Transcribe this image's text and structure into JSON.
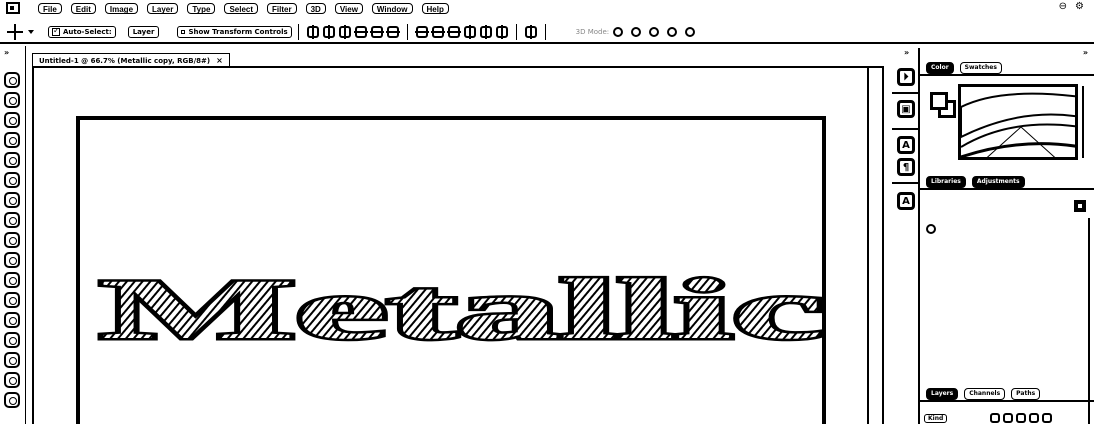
{
  "menubar": {
    "items": [
      "File",
      "Edit",
      "Image",
      "Layer",
      "Type",
      "Select",
      "Filter",
      "3D",
      "View",
      "Window",
      "Help"
    ]
  },
  "options": {
    "auto_select_label": "Auto-Select:",
    "auto_select_value": "Layer",
    "show_transform_label": "Show Transform Controls",
    "mode_3d_label": "3D Mode:"
  },
  "document": {
    "tab_title": "Untitled-1 @ 66.7% (Metallic copy, RGB/8#)",
    "close_glyph": "×",
    "canvas_text": "Metallic"
  },
  "panels": {
    "color_tab": "Color",
    "swatches_tab": "Swatches",
    "libraries_tab": "Libraries",
    "adjustments_tab": "Adjustments",
    "layers_tab": "Layers",
    "channels_tab": "Channels",
    "paths_tab": "Paths",
    "kind_label": "Kind"
  },
  "icons": {
    "app": "photoshop-logo",
    "move": "move-tool-icon"
  }
}
